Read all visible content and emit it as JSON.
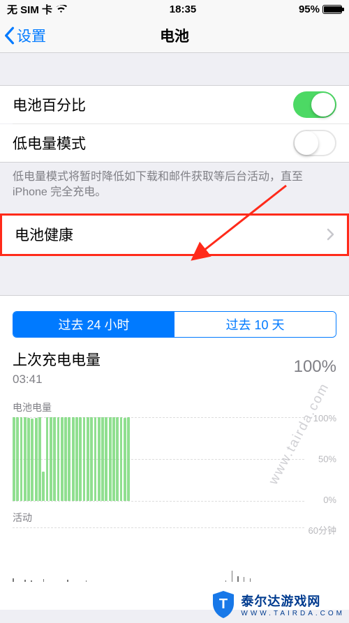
{
  "status": {
    "carrier": "无 SIM 卡",
    "time": "18:35",
    "battery_pct": "95%"
  },
  "nav": {
    "back_label": "设置",
    "title": "电池"
  },
  "rows": {
    "battery_percent": {
      "label": "电池百分比",
      "on": true
    },
    "low_power": {
      "label": "低电量模式",
      "on": false
    },
    "low_power_note": "低电量模式将暂时降低如下载和邮件获取等后台活动，直至 iPhone 完全充电。",
    "health": {
      "label": "电池健康"
    }
  },
  "segmented": {
    "left": "过去 24 小时",
    "right": "过去 10 天",
    "active": 0
  },
  "last_charge": {
    "title": "上次充电电量",
    "time": "03:41",
    "pct": "100%"
  },
  "chart_data": [
    {
      "type": "bar",
      "title": "电池电量",
      "ylabel": "%",
      "ylim": [
        0,
        100
      ],
      "y_ticks": [
        "100%",
        "50%",
        "0%"
      ],
      "values": [
        100,
        100,
        100,
        100,
        99,
        98,
        99,
        100,
        35,
        100,
        100,
        100,
        100,
        100,
        100,
        100,
        100,
        100,
        100,
        100,
        100,
        100,
        100,
        100,
        100,
        100,
        100,
        100,
        100,
        100,
        99,
        100
      ]
    },
    {
      "type": "bar",
      "title": "活动",
      "ylabel": "分钟",
      "ylim": [
        0,
        60
      ],
      "y_ticks": [
        "60分钟"
      ],
      "values": [
        4,
        0,
        2,
        1,
        0,
        3,
        0,
        0,
        0,
        2,
        0,
        0,
        1,
        0,
        0,
        0,
        0,
        0,
        0,
        0,
        0,
        0,
        0,
        0,
        0,
        0,
        0,
        0,
        0,
        0,
        0,
        0,
        0,
        0,
        0,
        1,
        12,
        6,
        5,
        4,
        0,
        0,
        0,
        0,
        0,
        0,
        0,
        0
      ]
    }
  ],
  "watermark": {
    "corner_cn": "泰尔达游戏网",
    "corner_url": "WWW.TAIRDA.COM",
    "diagonal": "www.tairda.com"
  }
}
